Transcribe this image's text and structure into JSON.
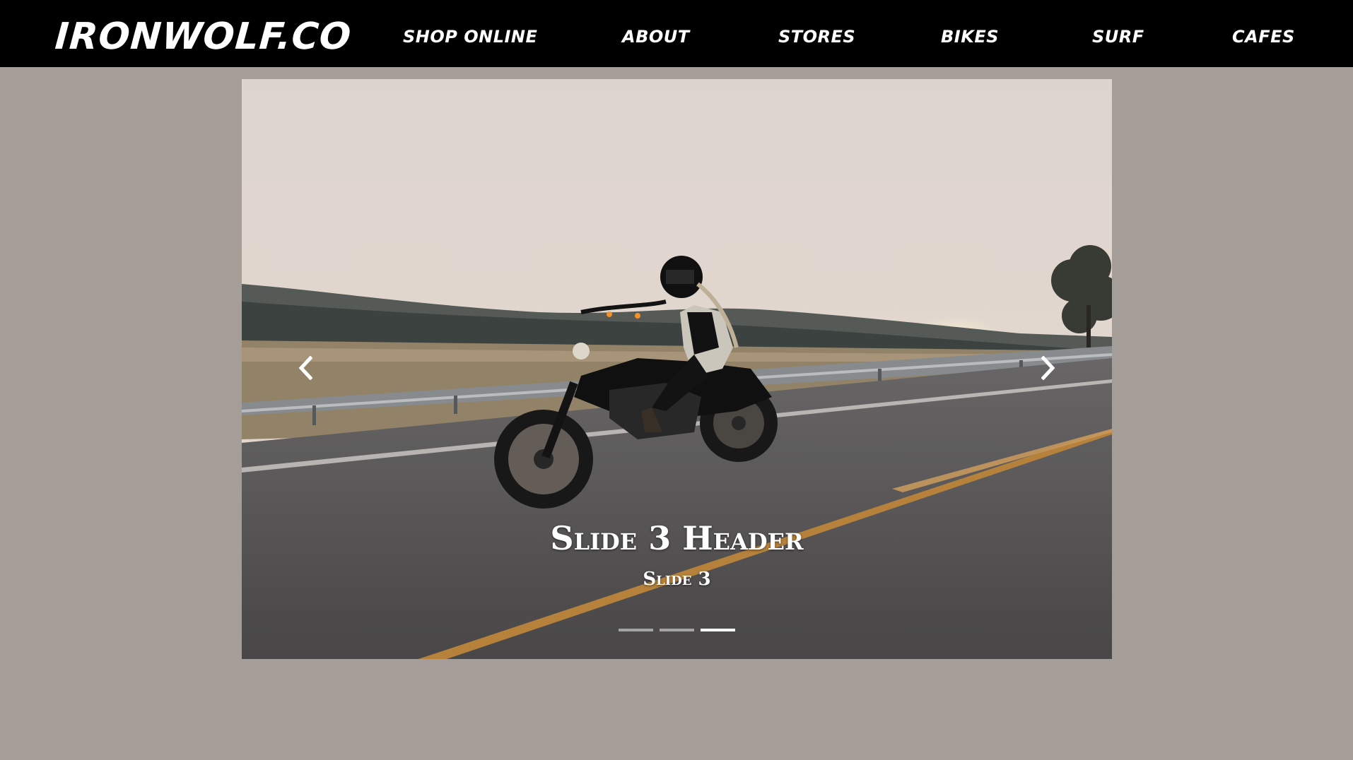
{
  "navbar": {
    "brand": "IRONWOLF.CO",
    "items": [
      {
        "label": "SHOP ONLINE"
      },
      {
        "label": "ABOUT"
      },
      {
        "label": "STORES"
      },
      {
        "label": "BIKES"
      },
      {
        "label": "SURF"
      },
      {
        "label": "CAFES"
      }
    ]
  },
  "carousel": {
    "active_slide": 3,
    "slide_count": 3,
    "caption": {
      "title": "Slide 3 Header",
      "text": "Slide 3"
    },
    "controls": {
      "prev_icon": "chevron-left-icon",
      "next_icon": "chevron-right-icon"
    },
    "image": "motorcyclist-on-highway-at-sunset"
  },
  "colors": {
    "navbar_bg": "#000000",
    "page_bg": "#a59e98",
    "text": "#ffffff"
  }
}
